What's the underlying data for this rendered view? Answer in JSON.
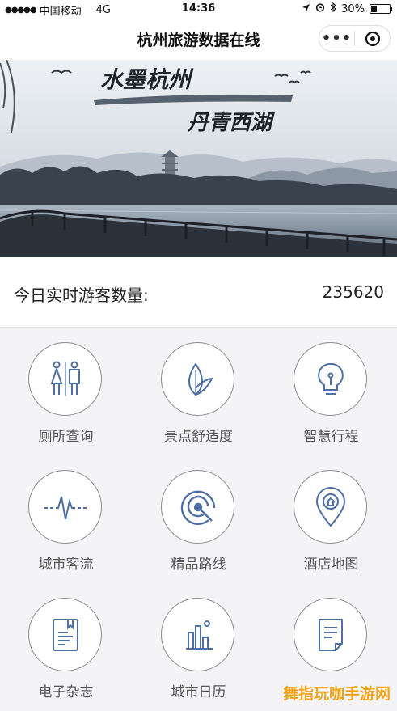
{
  "status_bar": {
    "carrier": "中国移动",
    "network": "4G",
    "time": "14:36",
    "battery": "30%",
    "battery_level": 0.3
  },
  "nav": {
    "title": "杭州旅游数据在线"
  },
  "banner": {
    "line1": "水墨杭州",
    "line2": "丹青西湖"
  },
  "visitors": {
    "label": "今日实时游客数量:",
    "value": "235620"
  },
  "menu": [
    {
      "label": "厕所查询",
      "icon": "restroom-icon"
    },
    {
      "label": "景点舒适度",
      "icon": "leaf-icon"
    },
    {
      "label": "智慧行程",
      "icon": "lightbulb-icon"
    },
    {
      "label": "城市客流",
      "icon": "pulse-icon"
    },
    {
      "label": "精品路线",
      "icon": "route-target-icon"
    },
    {
      "label": "酒店地图",
      "icon": "map-pin-home-icon"
    },
    {
      "label": "电子杂志",
      "icon": "magazine-icon"
    },
    {
      "label": "城市日历",
      "icon": "calendar-chart-icon"
    },
    {
      "label": "",
      "icon": "document-icon"
    }
  ],
  "watermark": "舞指玩咖手游网",
  "colors": {
    "icon_blue": "#4f6fa4",
    "ring": "#8c8c8c",
    "watermark": "#f3a11b"
  }
}
